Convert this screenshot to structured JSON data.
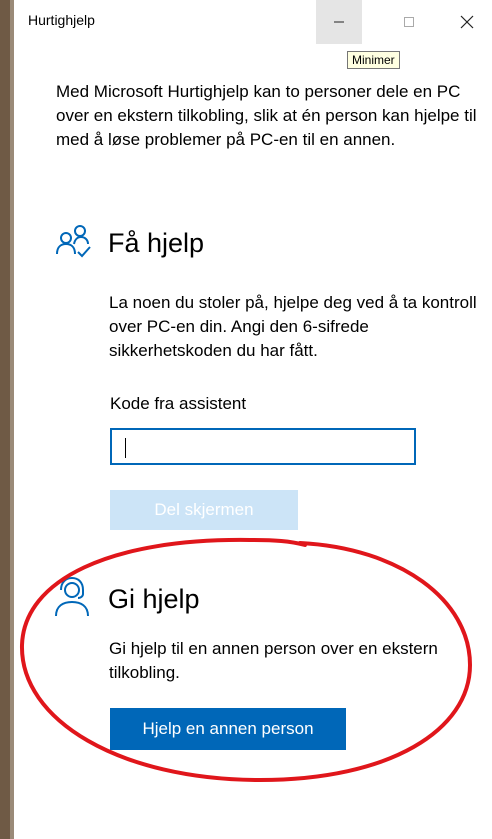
{
  "window": {
    "title": "Hurtighjelp",
    "minimize_tooltip": "Minimer"
  },
  "intro": "Med Microsoft Hurtighjelp kan to personer dele en PC over en ekstern tilkobling, slik at én person kan hjelpe til med å løse problemer på PC-en til en annen.",
  "get_help": {
    "heading": "Få hjelp",
    "description": "La noen du stoler på, hjelpe deg ved å ta kontroll over PC-en din. Angi den 6-sifrede sikkerhetskoden du har fått.",
    "code_label": "Kode fra assistent",
    "code_value": "",
    "share_button": "Del skjermen",
    "icon": "people-icon"
  },
  "give_help": {
    "heading": "Gi hjelp",
    "description": "Gi hjelp til en annen person over en ekstern tilkobling.",
    "button": "Hjelp en annen person",
    "icon": "headset-person-icon"
  },
  "colors": {
    "accent": "#0067b8",
    "disabled_button": "#cce4f7",
    "annotation_ellipse": "#e0161b"
  }
}
